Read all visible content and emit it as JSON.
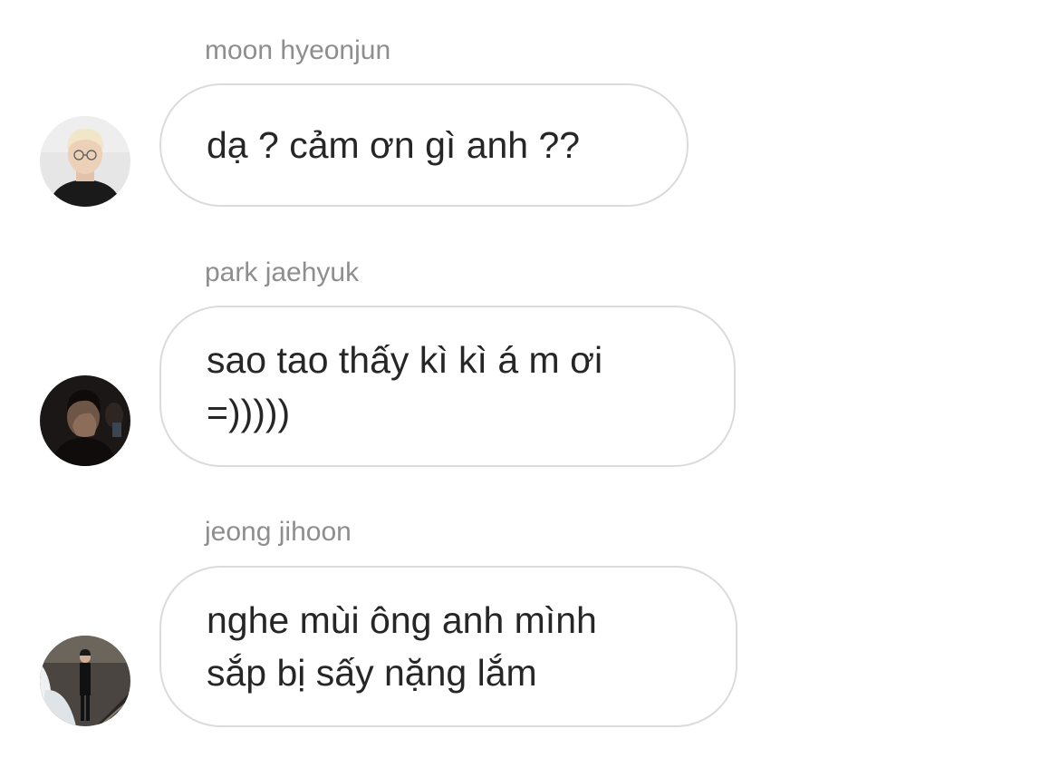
{
  "messages": [
    {
      "sender": "moon hyeonjun",
      "text": "dạ ? cảm ơn gì anh ??",
      "avatar_icon": "profile-photo-blond-man-glasses"
    },
    {
      "sender": "park jaehyuk",
      "text": "sao tao thấy kì kì á m ơi\n=)))))",
      "avatar_icon": "profile-photo-dark-man-hand-on-face"
    },
    {
      "sender": "jeong jihoon",
      "text": "nghe mùi ông anh mình\nsắp bị sấy nặng lắm",
      "avatar_icon": "profile-photo-man-suit-staircase"
    }
  ],
  "colors": {
    "background": "#ffffff",
    "sender_text": "#8e8e8e",
    "message_text": "#262626",
    "bubble_border": "#dbdbdb"
  }
}
